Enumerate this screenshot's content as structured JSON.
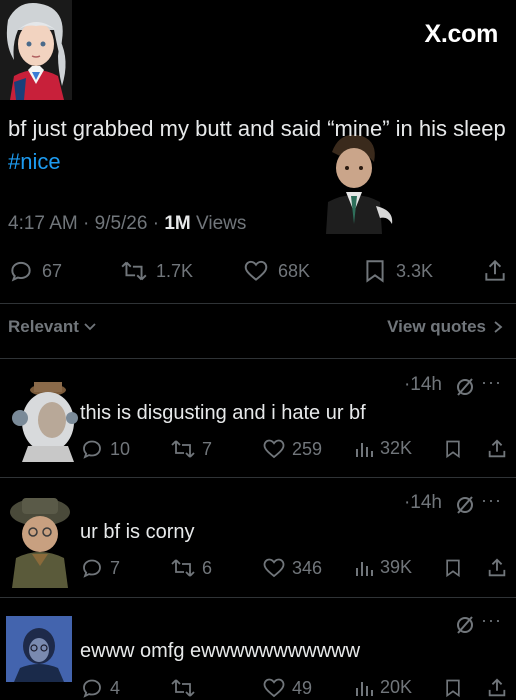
{
  "brand": {
    "site": "X.com"
  },
  "post": {
    "text_main": "bf just grabbed my butt and said “mine” in his sleep ",
    "hashtag": "#nice",
    "time": "4:17 AM",
    "date": "9/5/26",
    "views_count": "1M",
    "views_label": "Views",
    "stats": {
      "replies": "67",
      "reposts": "1.7K",
      "likes": "68K",
      "bookmarks": "3.3K"
    }
  },
  "filters": {
    "sort_label": "Relevant",
    "view_quotes_label": "View quotes"
  },
  "replies": [
    {
      "time": "14h",
      "text": "this is disgusting and i hate ur bf",
      "replies": "10",
      "reposts": "7",
      "likes": "259",
      "views": "32K"
    },
    {
      "time": "14h",
      "text": "ur bf is corny",
      "replies": "7",
      "reposts": "6",
      "likes": "346",
      "views": "39K"
    },
    {
      "time": "",
      "text": "ewww omfg ewwwwwwwwwww",
      "replies": "4",
      "reposts": "",
      "likes": "49",
      "views": "20K"
    }
  ],
  "colors": {
    "background": "#000000",
    "text": "#e7e9ea",
    "muted": "#71767b",
    "accent": "#1d9bf0",
    "divider": "#2f3336"
  },
  "icons": [
    "reply-icon",
    "repost-icon",
    "like-icon",
    "bookmark-icon",
    "share-icon",
    "views-icon",
    "chevron-down-icon",
    "chevron-right-icon",
    "grok-slash-icon",
    "more-icon"
  ]
}
